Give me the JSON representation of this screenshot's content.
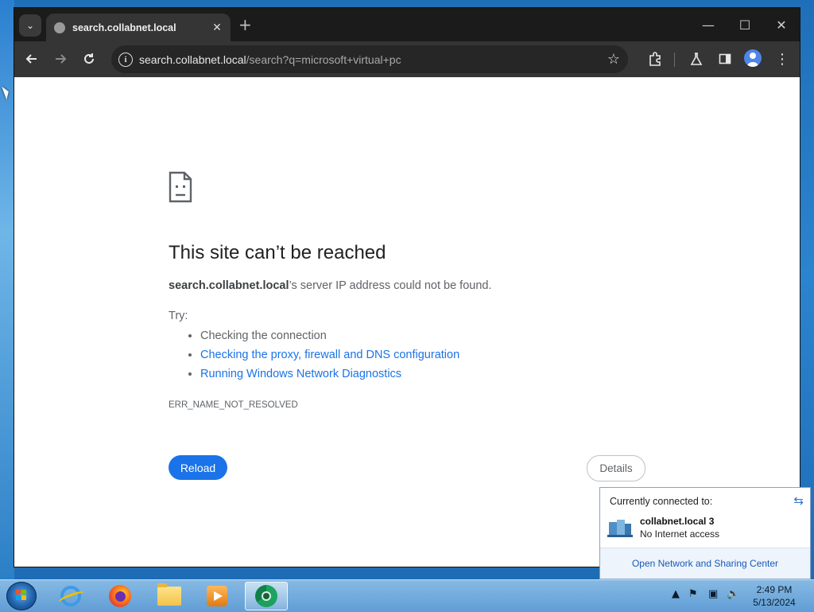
{
  "browser": {
    "tab": {
      "title": "search.collabnet.local"
    },
    "address": {
      "host": "search.collabnet.local",
      "path": "/search?q=microsoft+virtual+pc"
    }
  },
  "page": {
    "title": "This site can’t be reached",
    "host": "search.collabnet.local",
    "desc_suffix": "’s server IP address could not be found.",
    "try_label": "Try:",
    "suggestions": [
      {
        "text": "Checking the connection",
        "link": false
      },
      {
        "text": "Checking the proxy, firewall and DNS configuration",
        "link": true
      },
      {
        "text": "Running Windows Network Diagnostics",
        "link": true
      }
    ],
    "error_code": "ERR_NAME_NOT_RESOLVED",
    "reload_label": "Reload",
    "details_label": "Details"
  },
  "network_flyout": {
    "header": "Currently connected to:",
    "network_name": "collabnet.local  3",
    "status": "No Internet access",
    "footer_link": "Open Network and Sharing Center"
  },
  "taskbar": {
    "time": "2:49 PM",
    "date": "5/13/2024",
    "apps": [
      "internet-explorer-icon",
      "firefox-icon",
      "file-explorer-icon",
      "media-player-icon",
      "chrome-icon"
    ]
  },
  "colors": {
    "accent": "#1a73e8",
    "browser_frame": "#1b1b1b",
    "toolbar": "#353535",
    "link": "#1a73e8"
  }
}
